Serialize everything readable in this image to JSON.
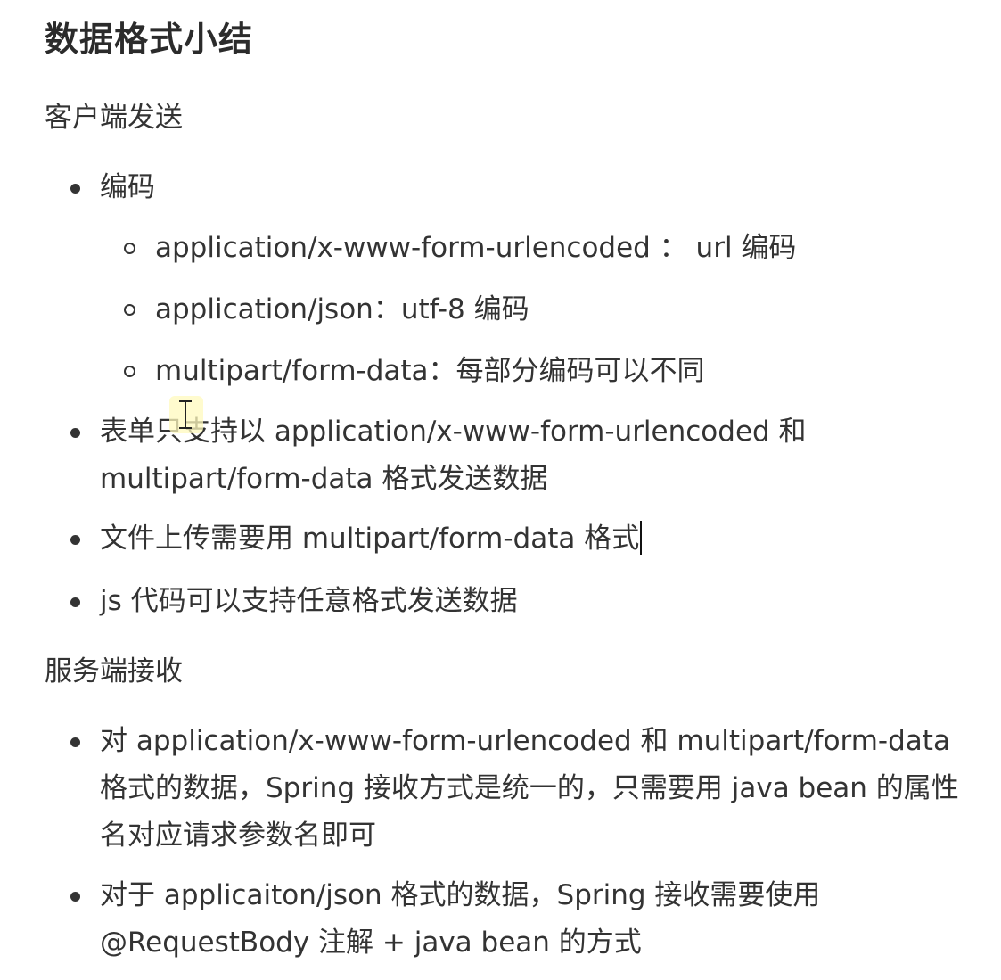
{
  "title": "数据格式小结",
  "client": {
    "heading": "客户端发送",
    "encoding": {
      "label": "编码",
      "items": [
        "application/x-www-form-urlencoded ： url 编码",
        "application/json：utf-8 编码",
        "multipart/form-data：每部分编码可以不同"
      ]
    },
    "points": [
      "表单只支持以 application/x-www-form-urlencoded 和 multipart/form-data 格式发送数据",
      "文件上传需要用 multipart/form-data 格式",
      "js 代码可以支持任意格式发送数据"
    ]
  },
  "server": {
    "heading": "服务端接收",
    "points": [
      "对 application/x-www-form-urlencoded 和 multipart/form-data 格式的数据，Spring 接收方式是统一的，只需要用 java bean 的属性名对应请求参数名即可",
      "对于 applicaiton/json 格式的数据，Spring 接收需要使用 @RequestBody 注解 + java bean 的方式"
    ]
  }
}
